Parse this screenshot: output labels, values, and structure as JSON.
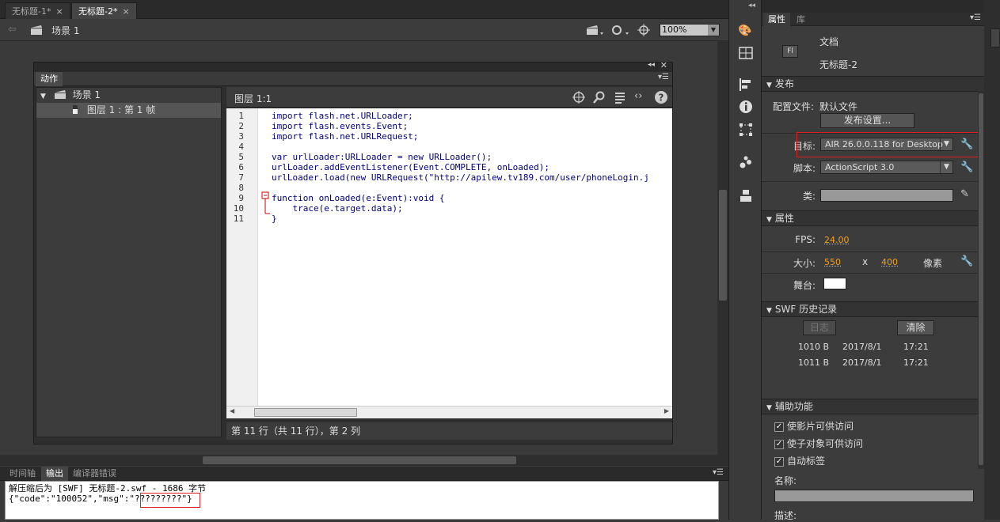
{
  "doc_tabs": [
    {
      "label": "无标题-1*",
      "close": "×"
    },
    {
      "label": "无标题-2*",
      "close": "×"
    }
  ],
  "scene_bar": {
    "scene_label": "场景 1",
    "zoom": "100%"
  },
  "actions_panel": {
    "tab_label": "动作",
    "tree": {
      "scene": "场景 1",
      "frame": "图层 1 : 第 1 帧"
    },
    "editor_title": "图层 1:1",
    "line_numbers": [
      "1",
      "2",
      "3",
      "4",
      "5",
      "6",
      "7",
      "8",
      "9",
      "10",
      "11"
    ],
    "code": [
      "import flash.net.URLLoader;",
      "import flash.events.Event;",
      "import flash.net.URLRequest;",
      "",
      "var urlLoader:URLLoader = new URLLoader();",
      "urlLoader.addEventListener(Event.COMPLETE, onLoaded);",
      "urlLoader.load(new URLRequest(\"http://apilew.tv189.com/user/phoneLogin.j",
      "",
      "function onLoaded(e:Event):void {",
      "    trace(e.target.data);",
      "}"
    ],
    "status": "第 11 行（共 11 行），第 2 列"
  },
  "output_panel": {
    "tabs": [
      "时间轴",
      "输出",
      "编译器错误"
    ],
    "active_tab": "输出",
    "lines": [
      "解压缩后为 [SWF] 无标题-2.swf - 1686 字节",
      "{\"code\":\"100052\",\"msg\":\"?????????\"}"
    ]
  },
  "properties": {
    "tabs": [
      "属性",
      "库"
    ],
    "doc_type": "文档",
    "doc_name": "无标题-2",
    "doc_icon_text": "Fl",
    "publish": {
      "section": "发布",
      "profile_label": "配置文件:",
      "profile_value": "默认文件",
      "settings_button": "发布设置...",
      "target_label": "目标:",
      "target_value": "AIR 26.0.0.118 for Desktop",
      "script_label": "脚本:",
      "script_value": "ActionScript 3.0",
      "class_label": "类:"
    },
    "props": {
      "section": "属性",
      "fps_label": "FPS:",
      "fps": "24.00",
      "size_label": "大小:",
      "width": "550",
      "x": "x",
      "height": "400",
      "unit": "像素",
      "stage_label": "舞台:",
      "stage_color": "#ffffff"
    },
    "swf_history": {
      "section": "SWF 历史记录",
      "log_button": "日志",
      "clear_button": "清除",
      "entries": [
        {
          "size": "1010 B",
          "date": "2017/8/1",
          "time": "17:21"
        },
        {
          "size": "1011 B",
          "date": "2017/8/1",
          "time": "17:21"
        }
      ]
    },
    "accessibility": {
      "section": "辅助功能",
      "options": [
        "使影片可供访问",
        "使子对象可供访问",
        "自动标签"
      ],
      "name_label": "名称:",
      "desc_label": "描述:"
    }
  },
  "colors": {
    "highlight": "#e02020",
    "numeric": "#f0a020"
  }
}
